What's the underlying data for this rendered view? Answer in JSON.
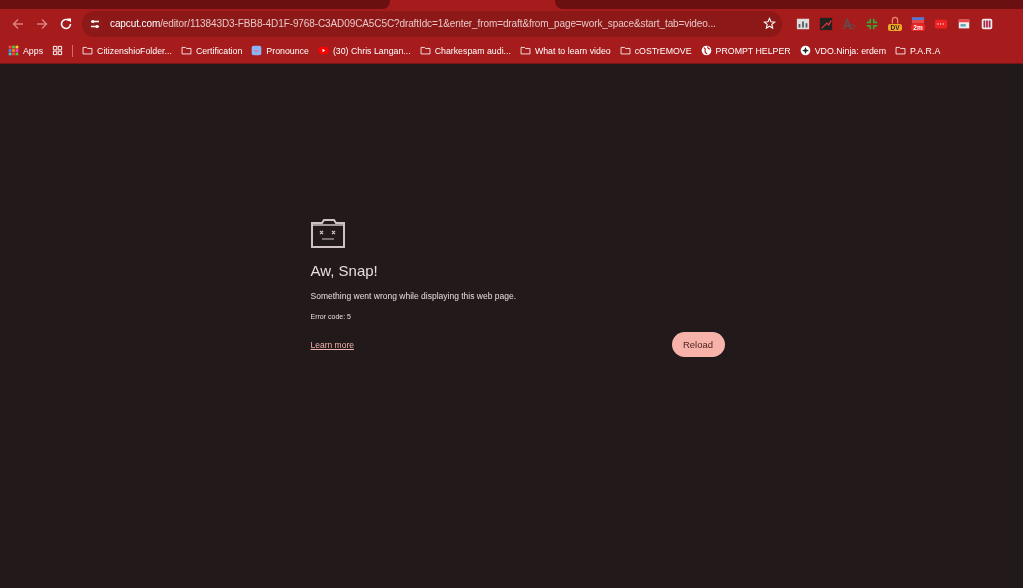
{
  "address_bar": {
    "host": "capcut.com",
    "path": "/editor/113843D3-FBB8-4D1F-9768-C3AD09CA5C5C?draftIdc=1&enter_from=draft&from_page=work_space&start_tab=video..."
  },
  "extensions": [
    {
      "kind": "chart"
    },
    {
      "kind": "graph"
    },
    {
      "kind": "font"
    },
    {
      "kind": "arrows"
    },
    {
      "kind": "lock",
      "badge": "DV"
    },
    {
      "kind": "calendar",
      "badge": "2m"
    },
    {
      "kind": "dots"
    },
    {
      "kind": "window"
    },
    {
      "kind": "book"
    }
  ],
  "bookmarks": [
    {
      "kind": "apps",
      "label": "Apps"
    },
    {
      "kind": "grid"
    },
    {
      "kind": "folder",
      "label": "CitizenshioFolder..."
    },
    {
      "kind": "folder",
      "label": "Certification"
    },
    {
      "kind": "site",
      "label": "Pronounce"
    },
    {
      "kind": "video",
      "label": "(30) Chris Langan..."
    },
    {
      "kind": "folder",
      "label": "Charkespam audi..."
    },
    {
      "kind": "folder",
      "label": "What to learn video"
    },
    {
      "kind": "folder",
      "label": "cOSTrEMOVE"
    },
    {
      "kind": "globe",
      "label": "PROMPT HELPER"
    },
    {
      "kind": "ninja",
      "label": "VDO.Ninja: erdem"
    },
    {
      "kind": "folder",
      "label": "P.A.R.A"
    }
  ],
  "error": {
    "title": "Aw, Snap!",
    "message": "Something went wrong while displaying this web page.",
    "code": "Error code: 5",
    "link": "Learn more",
    "button": "Reload"
  }
}
